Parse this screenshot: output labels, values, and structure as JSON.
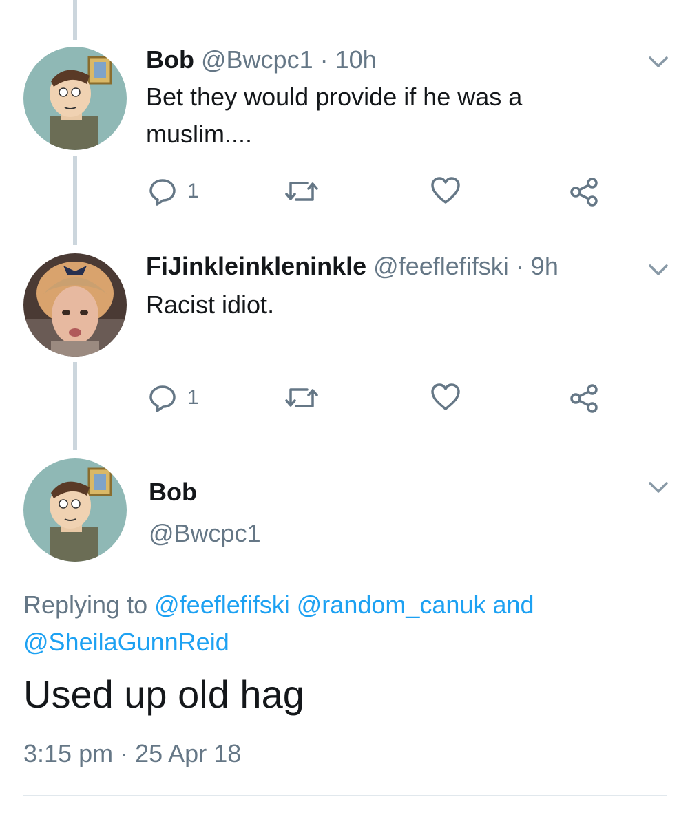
{
  "colors": {
    "text": "#14171a",
    "muted": "#657786",
    "link": "#1da1f2",
    "thread_line": "#ccd6dd"
  },
  "tweets": [
    {
      "display_name": "Bob",
      "handle": "@Bwcpc1",
      "sep": "·",
      "time": "10h",
      "text_line1": "Bet they would provide if he was a",
      "text_line2": "muslim....",
      "reply_count": "1",
      "avatar_icon": "cartoon-man-avatar"
    },
    {
      "display_name": "FiJinkleinkleninkle",
      "handle": "@feeflefifski",
      "sep": "·",
      "time": "9h",
      "text_line1": "Racist idiot.",
      "reply_count": "1",
      "avatar_icon": "woman-photo-avatar"
    }
  ],
  "main_tweet": {
    "display_name": "Bob",
    "handle": "@Bwcpc1",
    "replying_prefix": "Replying to",
    "reply_handle1": "@feeflefifski",
    "reply_handle2": "@random_canuk",
    "reply_and": "and",
    "reply_handle3": "@SheilaGunnReid",
    "text": "Used up old hag",
    "time": "3:15 pm",
    "sep": "·",
    "date": "25 Apr 18",
    "avatar_icon": "cartoon-man-avatar"
  }
}
